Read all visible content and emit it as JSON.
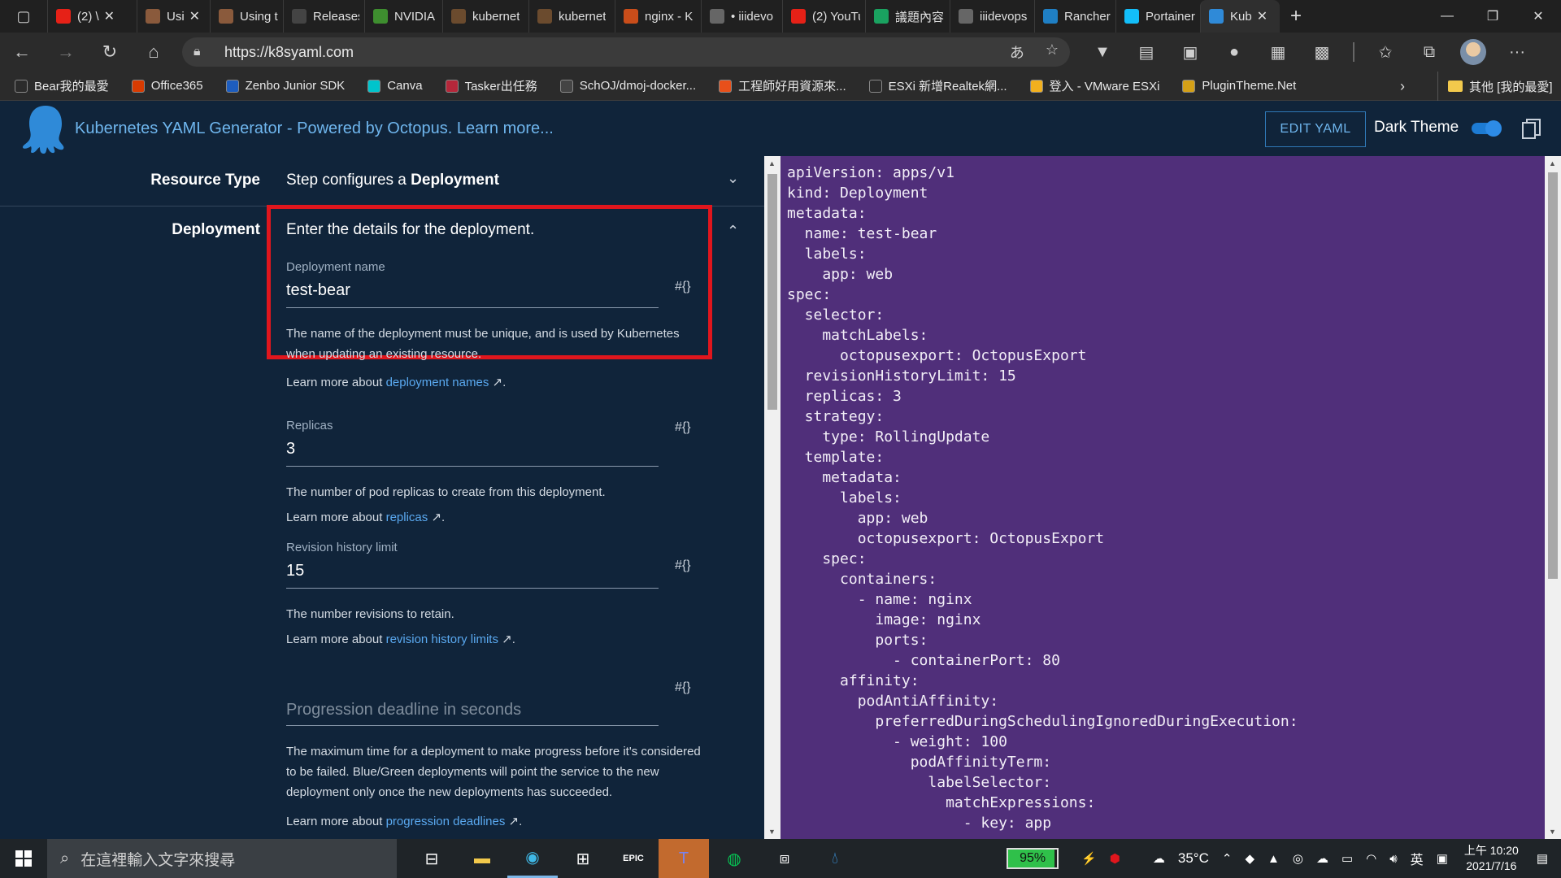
{
  "browser": {
    "tabs": [
      {
        "title": "(2) \\",
        "favicon_color": "#e62117",
        "closable": true
      },
      {
        "title": "Usi",
        "favicon_color": "#8a5a3c",
        "closable": true
      },
      {
        "title": "Using th",
        "favicon_color": "#8a5a3c",
        "closable": false
      },
      {
        "title": "Releases",
        "favicon_color": "#444444",
        "closable": false
      },
      {
        "title": "NVIDIA v",
        "favicon_color": "#3e8e2f",
        "closable": false
      },
      {
        "title": "kubernet",
        "favicon_color": "#6b4b2e",
        "closable": false
      },
      {
        "title": "kubernet",
        "favicon_color": "#6b4b2e",
        "closable": false
      },
      {
        "title": "nginx - K",
        "favicon_color": "#c94d1a",
        "closable": false
      },
      {
        "title": "• iiidevo",
        "favicon_color": "#666666",
        "closable": false
      },
      {
        "title": "(2) YouTu",
        "favicon_color": "#e62117",
        "closable": false
      },
      {
        "title": "議題內容",
        "favicon_color": "#1aa260",
        "closable": false
      },
      {
        "title": "iiidevops",
        "favicon_color": "#666666",
        "closable": false
      },
      {
        "title": "Rancher",
        "favicon_color": "#1f7fc4",
        "closable": false
      },
      {
        "title": "Portainer",
        "favicon_color": "#13bef9",
        "closable": false
      },
      {
        "title": "Kub",
        "favicon_color": "#2f8ad8",
        "closable": true,
        "active": true
      }
    ],
    "url": "https://k8syaml.com"
  },
  "bookmarks": [
    {
      "label": "Bear我的最愛",
      "color": "#2b2b2b"
    },
    {
      "label": "Office365",
      "color": "#d83b01"
    },
    {
      "label": "Zenbo Junior SDK",
      "color": "#1d5dbf"
    },
    {
      "label": "Canva",
      "color": "#00c4cc"
    },
    {
      "label": "Tasker出任務",
      "color": "#b5273a"
    },
    {
      "label": "SchOJ/dmoj-docker...",
      "color": "#444444"
    },
    {
      "label": "工程師好用資源來...",
      "color": "#e8501a"
    },
    {
      "label": "ESXi 新增Realtek網...",
      "color": "#2b2b2b"
    },
    {
      "label": "登入 - VMware ESXi",
      "color": "#f2b01e"
    },
    {
      "label": "PluginTheme.Net",
      "color": "#d4a017"
    }
  ],
  "bookmarks_other": "其他 [我的最愛]",
  "app": {
    "title": "Kubernetes YAML Generator - Powered by Octopus. Learn more...",
    "edit_yaml": "EDIT YAML",
    "dark_theme": "Dark Theme",
    "dark_theme_on": true
  },
  "form": {
    "resource_type": {
      "label": "Resource Type",
      "desc_prefix": "Step configures a ",
      "desc_bold": "Deployment"
    },
    "deployment": {
      "label": "Deployment",
      "desc": "Enter the details for the deployment."
    },
    "fields": {
      "name": {
        "label": "Deployment name",
        "value": "test-bear",
        "help": "The name of the deployment must be unique, and is used by Kubernetes when updating an existing resource.",
        "learn_prefix": "Learn more about ",
        "learn_link": "deployment names"
      },
      "replicas": {
        "label": "Replicas",
        "value": "3",
        "help": "The number of pod replicas to create from this deployment.",
        "learn_prefix": "Learn more about ",
        "learn_link": "replicas"
      },
      "revision": {
        "label": "Revision history limit",
        "value": "15",
        "help": "The number revisions to retain.",
        "learn_prefix": "Learn more about ",
        "learn_link": "revision history limits"
      },
      "progression": {
        "placeholder": "Progression deadline in seconds",
        "help": "The maximum time for a deployment to make progress before it's considered to be failed. Blue/Green deployments will point the service to the new deployment only once the new deployments has succeeded.",
        "learn_prefix": "Learn more about ",
        "learn_link": "progression deadlines"
      }
    },
    "hash_label": "#{}"
  },
  "yaml": "apiVersion: apps/v1\nkind: Deployment\nmetadata:\n  name: test-bear\n  labels:\n    app: web\nspec:\n  selector:\n    matchLabels:\n      octopusexport: OctopusExport\n  revisionHistoryLimit: 15\n  replicas: 3\n  strategy:\n    type: RollingUpdate\n  template:\n    metadata:\n      labels:\n        app: web\n        octopusexport: OctopusExport\n    spec:\n      containers:\n        - name: nginx\n          image: nginx\n          ports:\n            - containerPort: 80\n      affinity:\n        podAntiAffinity:\n          preferredDuringSchedulingIgnoredDuringExecution:\n            - weight: 100\n              podAffinityTerm:\n                labelSelector:\n                  matchExpressions:\n                    - key: app",
  "taskbar": {
    "search_placeholder": "在這裡輸入文字來搜尋",
    "battery": "95%",
    "temperature": "35°C",
    "ime": "英",
    "time": "上午 10:20",
    "date": "2021/7/16"
  }
}
